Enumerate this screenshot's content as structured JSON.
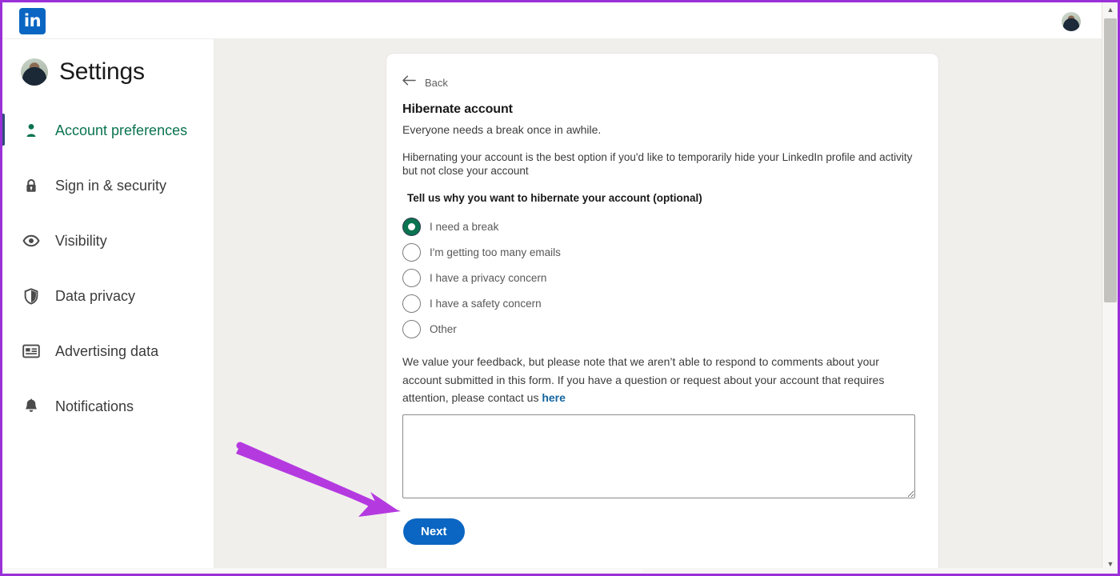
{
  "topbar": {
    "logo_text": "in",
    "logo_icon": "linkedin-logo-icon",
    "avatar_icon": "user-avatar-icon"
  },
  "sidebar": {
    "title": "Settings",
    "avatar_icon": "user-avatar-icon",
    "items": [
      {
        "label": "Account preferences",
        "icon": "person-icon",
        "active": true
      },
      {
        "label": "Sign in & security",
        "icon": "lock-icon",
        "active": false
      },
      {
        "label": "Visibility",
        "icon": "eye-icon",
        "active": false
      },
      {
        "label": "Data privacy",
        "icon": "shield-icon",
        "active": false
      },
      {
        "label": "Advertising data",
        "icon": "id-card-icon",
        "active": false
      },
      {
        "label": "Notifications",
        "icon": "bell-icon",
        "active": false
      }
    ]
  },
  "card": {
    "back_label": "Back",
    "back_icon": "arrow-left-icon",
    "title": "Hibernate account",
    "subtitle": "Everyone needs a break once in awhile.",
    "description": "Hibernating your account is the best option if you'd like to temporarily hide your LinkedIn profile and activity but not close your account",
    "radio_legend": "Tell us why you want to hibernate your account (optional)",
    "radio_options": [
      {
        "label": "I need a break",
        "selected": true
      },
      {
        "label": "I'm getting too many emails",
        "selected": false
      },
      {
        "label": "I have a privacy concern",
        "selected": false
      },
      {
        "label": "I have a safety concern",
        "selected": false
      },
      {
        "label": "Other",
        "selected": false
      }
    ],
    "feedback_note_part1": "We value your feedback, but please note that we aren’t able to respond to comments about your account submitted in this form. If you have a question or request about your account that requires attention, please contact us ",
    "feedback_note_link": "here",
    "comment_value": "",
    "comment_placeholder": "",
    "next_label": "Next"
  },
  "annotation": {
    "arrow_color": "#b43ae0",
    "arrow_icon": "pointer-arrow-icon",
    "frame_color": "#9b30d9"
  },
  "scrollbars": {
    "vertical_up_icon": "caret-up-icon",
    "vertical_down_icon": "caret-down-icon"
  },
  "colors": {
    "brand_blue": "#0a66c2",
    "accent_green": "#0a7350",
    "link_blue": "#1565a0",
    "content_bg": "#f1efec"
  }
}
